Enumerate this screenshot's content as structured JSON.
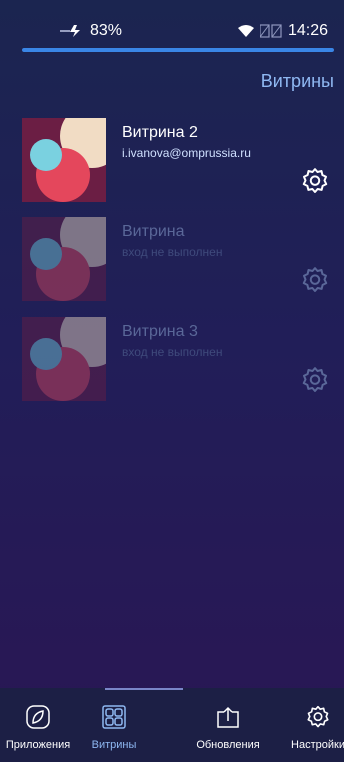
{
  "status_bar": {
    "battery": "83%",
    "time": "14:26"
  },
  "progress": {
    "fraction": 1.0
  },
  "page_title": "Витрины",
  "showcases": [
    {
      "name": "Витрина 2",
      "subtitle": "i.ivanova@omprussia.ru",
      "active": true
    },
    {
      "name": "Витрина",
      "subtitle": "вход не выполнен",
      "active": false
    },
    {
      "name": "Витрина 3",
      "subtitle": "вход не выполнен",
      "active": false
    }
  ],
  "tabs": [
    {
      "label": "Приложения",
      "icon": "apps-icon"
    },
    {
      "label": "Витрины",
      "icon": "grid-icon",
      "active": true
    },
    {
      "label": "Обновления",
      "icon": "updates-icon"
    },
    {
      "label": "Настройки",
      "icon": "settings-gear-icon"
    }
  ],
  "colors": {
    "accent": "#3a86e6",
    "title": "#8fb8f2",
    "bg_top": "#1b2550",
    "bg_bottom": "#2a1654"
  }
}
